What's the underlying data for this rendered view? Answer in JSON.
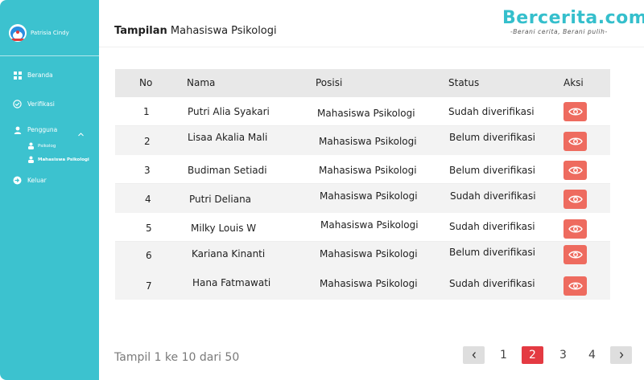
{
  "sidebar": {
    "profile_name": "Patrisia Cindy",
    "items": [
      {
        "label": "Beranda",
        "icon": "dashboard-icon"
      },
      {
        "label": "Verifikasi",
        "icon": "check-circle-icon"
      },
      {
        "label": "Pengguna",
        "icon": "user-icon"
      },
      {
        "label": "Keluar",
        "icon": "logout-icon"
      }
    ],
    "sub_items": [
      {
        "label": "Psikolog",
        "icon": "user-group-icon"
      },
      {
        "label": "Mahasiswa Psikologi",
        "icon": "user-group-icon"
      }
    ]
  },
  "header": {
    "title_bold": "Tampilan",
    "title_rest": " Mahasiswa Psikologi",
    "brand": "Bercerita.com",
    "tagline": "-Berani cerita, Berani pulih-"
  },
  "table": {
    "columns": [
      "No",
      "Nama",
      "Posisi",
      "Status",
      "Aksi"
    ],
    "rows": [
      {
        "no": "1",
        "nama": "Putri Alia Syakari",
        "posisi": "Mahasiswa Psikologi",
        "status": "Sudah diverifikasi"
      },
      {
        "no": "2",
        "nama": "Lisaa Akalia Mali",
        "posisi": "Mahasiswa Psikologi",
        "status": "Belum diverifikasi"
      },
      {
        "no": "3",
        "nama": "Budiman Setiadi",
        "posisi": "Mahasiswa Psikologi",
        "status": "Belum diverifikasi"
      },
      {
        "no": "4",
        "nama": "Putri Deliana",
        "posisi": "Mahasiswa Psikologi",
        "status": "Sudah diverifikasi"
      },
      {
        "no": "5",
        "nama": "Milky Louis W",
        "posisi": "Mahasiswa Psikologi",
        "status": "Sudah diverifikasi"
      },
      {
        "no": "6",
        "nama": "Kariana Kinanti",
        "posisi": "Mahasiswa Psikologi",
        "status": "Belum diverifikasi"
      },
      {
        "no": "7",
        "nama": "Hana Fatmawati",
        "posisi": "Mahasiswa Psikologi",
        "status": "Sudah diverifikasi"
      }
    ]
  },
  "footer": {
    "summary": "Tampil 1 ke 10 dari 50",
    "pages": [
      "1",
      "2",
      "3",
      "4"
    ],
    "current_page": "2",
    "prev_label": "‹",
    "next_label": "›"
  },
  "colors": {
    "sidebar": "#3cc2cf",
    "action": "#ee6b5f",
    "active_page": "#e43a42"
  }
}
